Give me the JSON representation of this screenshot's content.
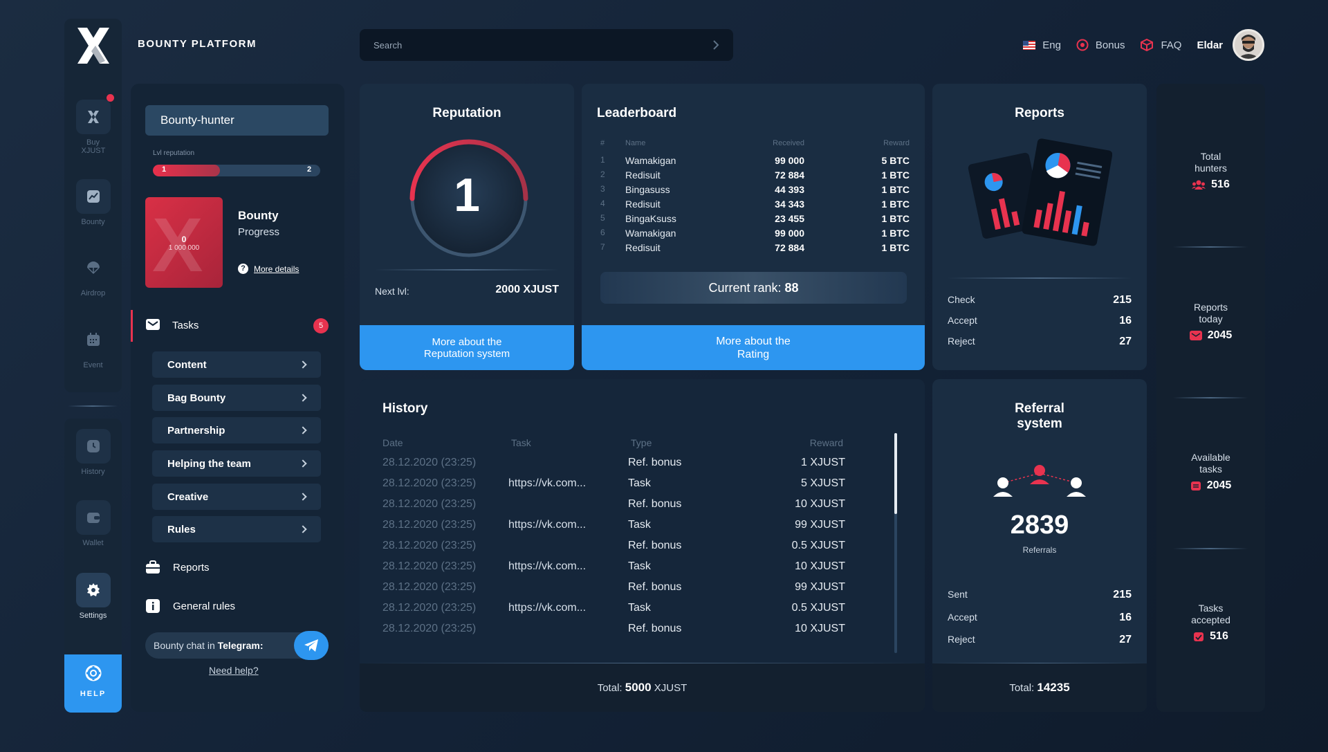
{
  "brand": "BOUNTY PLATFORM",
  "search": {
    "placeholder": "Search"
  },
  "header": {
    "lang": "Eng",
    "bonus": "Bonus",
    "faq": "FAQ",
    "user": "Eldar"
  },
  "rail": {
    "items": [
      {
        "label": "Buy XJUST",
        "icon": "x-logo-icon"
      },
      {
        "label": "Bounty",
        "icon": "chart-icon"
      },
      {
        "label": "Airdrop",
        "icon": "parachute-icon"
      },
      {
        "label": "Event",
        "icon": "calendar-icon"
      },
      {
        "label": "History",
        "icon": "clock-icon"
      },
      {
        "label": "Wallet",
        "icon": "wallet-icon"
      },
      {
        "label": "Settings",
        "icon": "gear-icon"
      }
    ],
    "help": "HELP"
  },
  "sidebar": {
    "title": "Bounty-hunter",
    "lvl_label": "Lvl reputation",
    "lvl_from": "1",
    "lvl_to": "2",
    "lvl_progress": 0.4,
    "card_value": "0",
    "card_target": "1 000 000",
    "bounty_title": "Bounty",
    "bounty_sub": "Progress",
    "more_details": "More details",
    "tasks_label": "Tasks",
    "tasks_badge": "5",
    "subtasks": [
      "Content",
      "Bag Bounty",
      "Partnership",
      "Helping the team",
      "Creative",
      "Rules"
    ],
    "reports": "Reports",
    "general_rules": "General rules",
    "chat_prefix": "Bounty chat in ",
    "chat_bold": "Telegram:",
    "need_help": "Need help?"
  },
  "reputation": {
    "title": "Reputation",
    "value": "1",
    "next_label": "Next lvl:",
    "next_value": "2000 XJUST",
    "button_line1": "More about the",
    "button_line2": "Reputation system"
  },
  "leaderboard": {
    "title": "Leaderboard",
    "cols": {
      "num": "#",
      "name": "Name",
      "received": "Received",
      "reward": "Reward"
    },
    "rows": [
      {
        "n": "1",
        "name": "Wamakigan",
        "received": "99 000",
        "reward": "5 BTC"
      },
      {
        "n": "2",
        "name": "Redisuit",
        "received": "72 884",
        "reward": "1 BTC"
      },
      {
        "n": "3",
        "name": "Bingasuss",
        "received": "44 393",
        "reward": "1 BTC"
      },
      {
        "n": "4",
        "name": "Redisuit",
        "received": "34 343",
        "reward": "1 BTC"
      },
      {
        "n": "5",
        "name": "BingaKsuss",
        "received": "23 455",
        "reward": "1 BTC"
      },
      {
        "n": "6",
        "name": "Wamakigan",
        "received": "99 000",
        "reward": "1 BTC"
      },
      {
        "n": "7",
        "name": "Redisuit",
        "received": "72 884",
        "reward": "1 BTC"
      }
    ],
    "rank_label": "Current rank:",
    "rank_value": "88",
    "button_line1": "More about the",
    "button_line2": "Rating"
  },
  "reports": {
    "title": "Reports",
    "check_label": "Check",
    "check_value": "215",
    "accept_label": "Accept",
    "accept_value": "16",
    "reject_label": "Reject",
    "reject_value": "27"
  },
  "history": {
    "title": "History",
    "cols": {
      "date": "Date",
      "task": "Task",
      "type": "Type",
      "reward": "Reward"
    },
    "rows": [
      {
        "date": "28.12.2020 (23:25)",
        "task": "",
        "type": "Ref. bonus",
        "reward": "1 XJUST"
      },
      {
        "date": "28.12.2020 (23:25)",
        "task": "https://vk.com...",
        "type": "Task",
        "reward": "5 XJUST"
      },
      {
        "date": "28.12.2020 (23:25)",
        "task": "",
        "type": "Ref. bonus",
        "reward": "10 XJUST"
      },
      {
        "date": "28.12.2020 (23:25)",
        "task": "https://vk.com...",
        "type": "Task",
        "reward": "99 XJUST"
      },
      {
        "date": "28.12.2020 (23:25)",
        "task": "",
        "type": "Ref. bonus",
        "reward": "0.5 XJUST"
      },
      {
        "date": "28.12.2020 (23:25)",
        "task": "https://vk.com...",
        "type": "Task",
        "reward": "10 XJUST"
      },
      {
        "date": "28.12.2020 (23:25)",
        "task": "",
        "type": "Ref. bonus",
        "reward": "99 XJUST"
      },
      {
        "date": "28.12.2020 (23:25)",
        "task": "https://vk.com...",
        "type": "Task",
        "reward": "0.5 XJUST"
      },
      {
        "date": "28.12.2020 (23:25)",
        "task": "",
        "type": "Ref. bonus",
        "reward": "10 XJUST"
      }
    ],
    "total_label": "Total:",
    "total_value": "5000",
    "total_unit": "XJUST"
  },
  "referral": {
    "title_line1": "Referral",
    "title_line2": "system",
    "count": "2839",
    "count_label": "Referrals",
    "sent_label": "Sent",
    "sent_value": "215",
    "accept_label": "Accept",
    "accept_value": "16",
    "reject_label": "Reject",
    "reject_value": "27",
    "total_label": "Total:",
    "total_value": "14235"
  },
  "stats": [
    {
      "line1": "Total",
      "line2": "hunters",
      "value": "516",
      "icon": "users-icon"
    },
    {
      "line1": "Reports",
      "line2": "today",
      "value": "2045",
      "icon": "mail-icon"
    },
    {
      "line1": "Available",
      "line2": "tasks",
      "value": "2045",
      "icon": "calendar-icon"
    },
    {
      "line1": "Tasks",
      "line2": "accepted",
      "value": "516",
      "icon": "check-calendar-icon"
    }
  ],
  "colors": {
    "accent_red": "#e8334f",
    "accent_blue": "#2d96f0",
    "card_bg": "#1a2d42"
  }
}
